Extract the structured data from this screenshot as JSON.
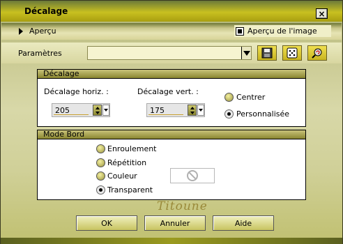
{
  "window": {
    "title": "Décalage",
    "close_glyph": "×"
  },
  "preview": {
    "toggle_label": "Aperçu",
    "image_label": "Aperçu de l'image",
    "image_checked": true
  },
  "params": {
    "label": "Paramètres",
    "value": ""
  },
  "offset": {
    "heading": "Décalage",
    "horiz_label": "Décalage horiz. :",
    "horiz_value": "205",
    "vert_label": "Décalage vert. :",
    "vert_value": "175",
    "options": [
      "Centrer",
      "Personnalisée"
    ],
    "selected": "Personnalisée"
  },
  "edge_mode": {
    "heading": "Mode Bord",
    "options": [
      "Enroulement",
      "Répétition",
      "Couleur",
      "Transparent"
    ],
    "selected": "Transparent"
  },
  "signature": "Titoune",
  "buttons": {
    "ok": "OK",
    "cancel": "Annuler",
    "help": "Aide"
  },
  "icons": {
    "close": "close-icon",
    "toggle": "triangle-right-icon",
    "params_dropdown": "chevron-down-icon",
    "save": "floppy-disk-icon",
    "random": "dice-icon",
    "reset": "magnifier-reset-icon",
    "no_color": "no-sign-icon"
  },
  "colors": {
    "accent": "#c8c020",
    "group_head": "#8a8630"
  }
}
